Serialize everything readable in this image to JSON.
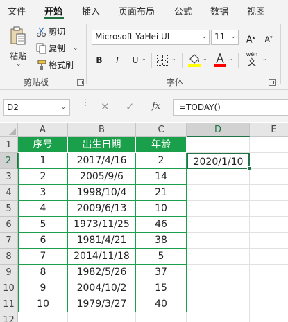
{
  "ribbon_tabs": [
    {
      "label": "文件",
      "active": false
    },
    {
      "label": "开始",
      "active": true
    },
    {
      "label": "插入",
      "active": false
    },
    {
      "label": "页面布局",
      "active": false
    },
    {
      "label": "公式",
      "active": false
    },
    {
      "label": "数据",
      "active": false
    },
    {
      "label": "视图",
      "active": false
    }
  ],
  "clipboard": {
    "paste_label": "粘贴",
    "cut_label": "剪切",
    "copy_label": "复制",
    "format_painter_label": "格式刷",
    "group_label": "剪贴板"
  },
  "font_group": {
    "font_name": "Microsoft YaHei UI",
    "font_size": "11",
    "grow_label": "A",
    "shrink_label": "A",
    "bold_label": "B",
    "italic_label": "I",
    "underline_label": "U",
    "phonetic_label": "wén",
    "phonetic_char": "文",
    "group_label": "字体"
  },
  "colors": {
    "accent": "#217346",
    "table_header_bg": "#1aa04a",
    "fill_color_bar": "#ffff00",
    "font_color_bar": "#ff0000"
  },
  "formula_bar": {
    "name_box": "D2",
    "fx_label": "fx",
    "formula": "=TODAY()"
  },
  "grid": {
    "columns": [
      "A",
      "B",
      "C",
      "D",
      "E"
    ],
    "selected_column": "D",
    "rows": [
      "1",
      "2",
      "3",
      "4",
      "5",
      "6",
      "7",
      "8",
      "9",
      "10",
      "11",
      "12"
    ],
    "selected_row": "2",
    "table_headers": [
      "序号",
      "出生日期",
      "年龄"
    ],
    "table_rows": [
      [
        "1",
        "2017/4/16",
        "2"
      ],
      [
        "2",
        "2005/9/6",
        "14"
      ],
      [
        "3",
        "1998/10/4",
        "21"
      ],
      [
        "4",
        "2009/6/13",
        "10"
      ],
      [
        "5",
        "1973/11/25",
        "46"
      ],
      [
        "6",
        "1981/4/21",
        "38"
      ],
      [
        "7",
        "2014/11/18",
        "5"
      ],
      [
        "8",
        "1982/5/26",
        "37"
      ],
      [
        "9",
        "2004/10/2",
        "15"
      ],
      [
        "10",
        "1979/3/27",
        "40"
      ]
    ],
    "active_cell_value": "2020/1/10"
  }
}
